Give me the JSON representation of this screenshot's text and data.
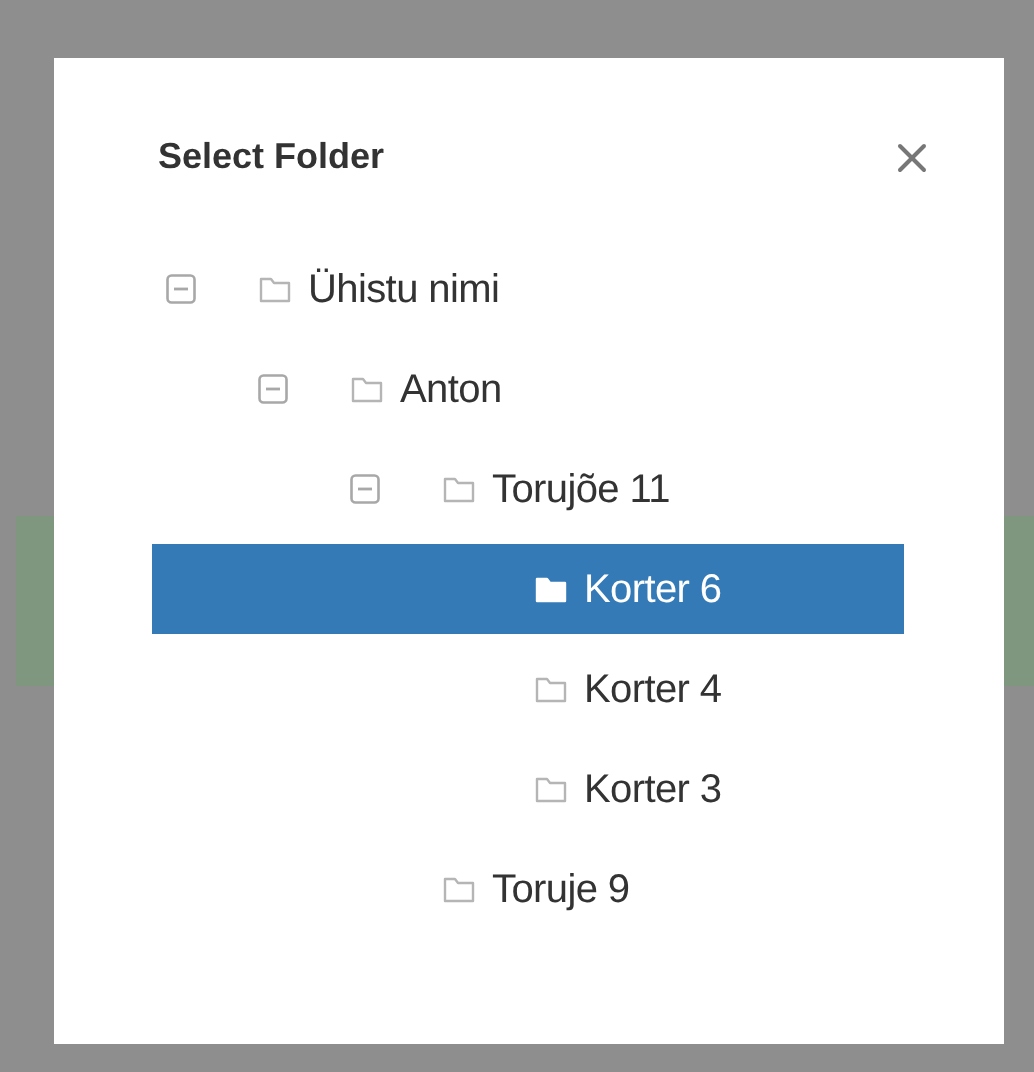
{
  "dialog": {
    "title": "Select Folder"
  },
  "tree": [
    {
      "label": "Ühistu nimi",
      "selected": false,
      "expanded": true,
      "children": [
        {
          "label": "Anton",
          "selected": false,
          "expanded": true,
          "children": [
            {
              "label": "Torujõe 11",
              "selected": false,
              "expanded": true,
              "children": [
                {
                  "label": "Korter 6",
                  "selected": true
                },
                {
                  "label": "Korter 4",
                  "selected": false
                },
                {
                  "label": "Korter 3",
                  "selected": false
                }
              ]
            },
            {
              "label": "Toruje 9",
              "selected": false
            }
          ]
        }
      ]
    }
  ]
}
